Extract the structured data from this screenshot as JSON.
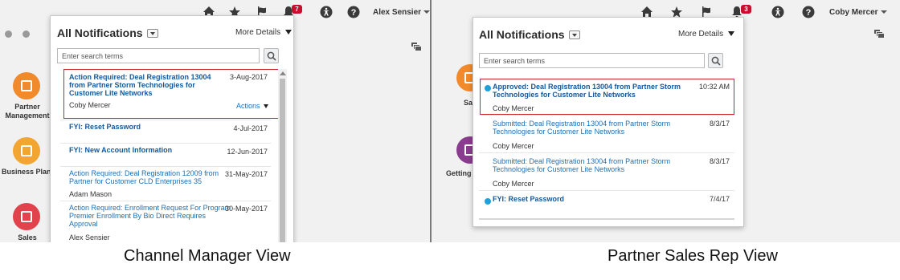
{
  "captions": {
    "left": "Channel Manager View",
    "right": "Partner Sales Rep View"
  },
  "header_icons": [
    "home-icon",
    "star-icon",
    "flag-icon",
    "bell-icon",
    "accessibility-icon",
    "help-icon"
  ],
  "colors": {
    "badge": "#c8102e",
    "link": "#1c6fb6",
    "highlight_border": "#d0212f",
    "unread_dot": "#1ea0dc"
  },
  "left": {
    "user_name": "Alex Sensier",
    "notification_count": "7",
    "apps": [
      {
        "label": "Partner\nManagement",
        "color": "#f08a2b"
      },
      {
        "label": "Business Plans",
        "color": "#f2a531"
      },
      {
        "label": "Sales",
        "color": "#e0434b"
      }
    ],
    "panel": {
      "title": "All Notifications",
      "more_details": "More Details",
      "search_placeholder": "Enter search terms",
      "actions_label": "Actions",
      "items": [
        {
          "title": "Action Required: Deal Registration 13004 from Partner Storm Technologies for Customer Lite Networks",
          "date": "3-Aug-2017",
          "sender": "Coby Mercer"
        },
        {
          "title": "FYI: Reset Password",
          "date": "4-Jul-2017",
          "sender": ""
        },
        {
          "title": "FYI: New Account Information",
          "date": "12-Jun-2017",
          "sender": ""
        },
        {
          "title": "Action Required: Deal Registration 12009 from Partner for Customer CLD Enterprises 35",
          "date": "31-May-2017",
          "sender": "Adam Mason"
        },
        {
          "title": "Action Required: Enrollment Request For Program Premier Enrollment By Bio Direct Requires Approval",
          "date": "30-May-2017",
          "sender": "Alex Sensier"
        }
      ]
    }
  },
  "right": {
    "user_name": "Coby Mercer",
    "notification_count": "3",
    "apps": [
      {
        "label": "Sa",
        "color": "#f08a2b"
      },
      {
        "label": "Getting",
        "color": "#8a3c8f"
      }
    ],
    "panel": {
      "title": "All Notifications",
      "more_details": "More Details",
      "search_placeholder": "Enter search terms",
      "items": [
        {
          "title": "Approved: Deal Registration 13004 from Partner Storm Technologies for Customer Lite Networks",
          "date": "10:32 AM",
          "sender": "Coby Mercer",
          "unread": true
        },
        {
          "title": "Submitted: Deal Registration 13004 from Partner Storm Technologies for Customer Lite Networks",
          "date": "8/3/17",
          "sender": "Coby Mercer",
          "unread": false
        },
        {
          "title": "Submitted: Deal Registration 13004 from Partner Storm Technologies for Customer Lite Networks",
          "date": "8/3/17",
          "sender": "Coby Mercer",
          "unread": false
        },
        {
          "title": "FYI: Reset Password",
          "date": "7/4/17",
          "sender": "",
          "unread": true
        }
      ]
    }
  }
}
